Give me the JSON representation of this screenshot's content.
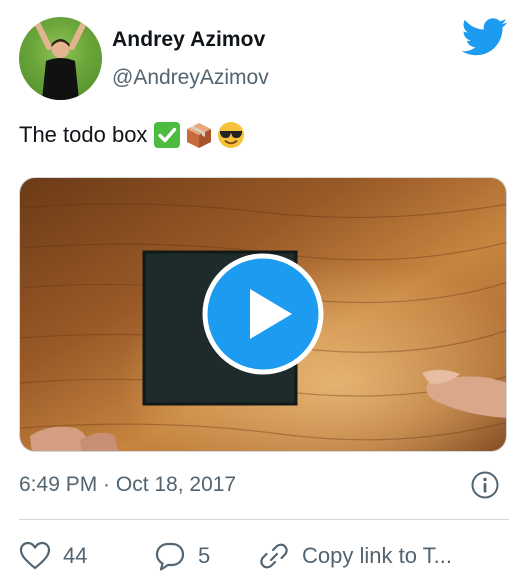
{
  "author": {
    "name": "Andrey Azimov",
    "handle": "@AndreyAzimov"
  },
  "tweet": {
    "text": "The todo box",
    "emojis": [
      "check-mark-button-emoji",
      "package-emoji",
      "smiling-face-with-sunglasses-emoji"
    ]
  },
  "media": {
    "type": "video",
    "play_icon": "play-icon"
  },
  "meta": {
    "timestamp": "6:49 PM · Oct 18, 2017"
  },
  "actions": {
    "likes": "44",
    "replies": "5",
    "copy_link": "Copy link to T..."
  },
  "colors": {
    "twitter_blue": "#1d9bf0",
    "secondary_text": "#536471",
    "divider": "#cfd9de"
  }
}
